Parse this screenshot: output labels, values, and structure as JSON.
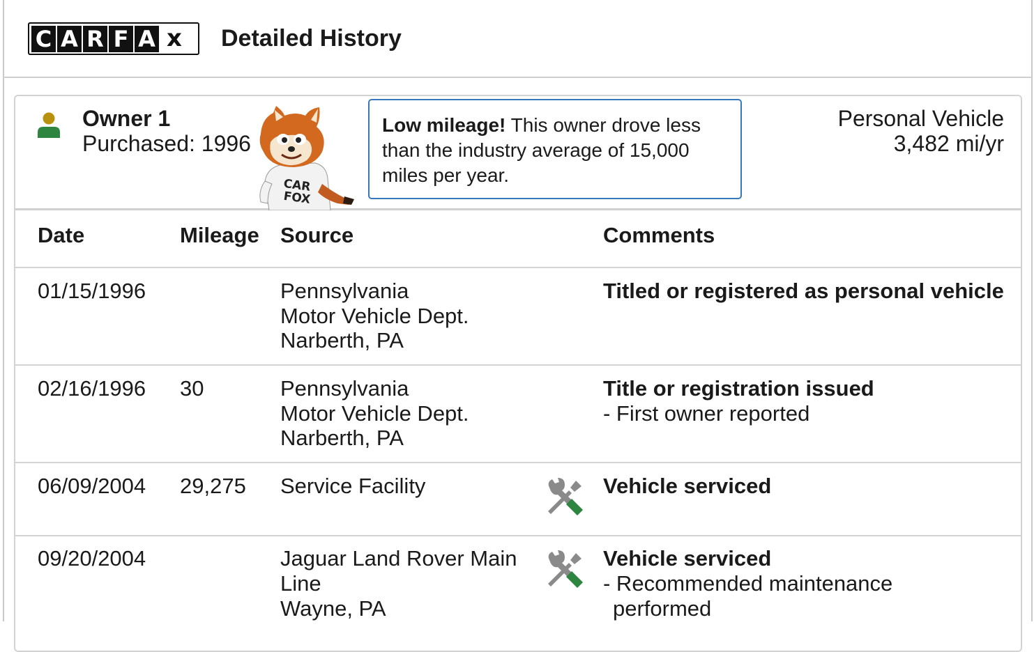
{
  "header": {
    "logo_letters": [
      "C",
      "A",
      "R",
      "F",
      "A",
      "x"
    ],
    "title": "Detailed History"
  },
  "owner": {
    "title": "Owner 1",
    "purchased": "Purchased: 1996",
    "mascot_shirt": "CAR FOX",
    "callout_bold": "Low mileage!",
    "callout_text": " This owner drove less than the industry average of 15,000 miles per year.",
    "usage_type": "Personal Vehicle",
    "usage_miles": "3,482 mi/yr",
    "colors": {
      "icon_green": "#2e8540",
      "icon_gold": "#b8910f",
      "callout_border": "#3777bc"
    }
  },
  "table": {
    "headers": {
      "date": "Date",
      "mileage": "Mileage",
      "source": "Source",
      "comments": "Comments"
    },
    "rows": [
      {
        "date": "01/15/1996",
        "mileage": "",
        "source": [
          "Pennsylvania",
          "Motor Vehicle Dept.",
          "Narberth, PA"
        ],
        "icon": "",
        "comment_title": "Titled or registered as personal vehicle",
        "comment_details": []
      },
      {
        "date": "02/16/1996",
        "mileage": "30",
        "source": [
          "Pennsylvania",
          "Motor Vehicle Dept.",
          "Narberth, PA"
        ],
        "icon": "",
        "comment_title": "Title or registration issued",
        "comment_details": [
          "- First owner reported"
        ]
      },
      {
        "date": "06/09/2004",
        "mileage": "29,275",
        "source": [
          "Service Facility"
        ],
        "icon": "service-wrench-icon",
        "comment_title": "Vehicle serviced",
        "comment_details": []
      },
      {
        "date": "09/20/2004",
        "mileage": "",
        "source": [
          "Jaguar Land Rover Main",
          "Line",
          "Wayne, PA"
        ],
        "icon": "service-wrench-icon",
        "comment_title": "Vehicle serviced",
        "comment_details": [
          "- Recommended maintenance",
          "performed"
        ]
      }
    ]
  }
}
